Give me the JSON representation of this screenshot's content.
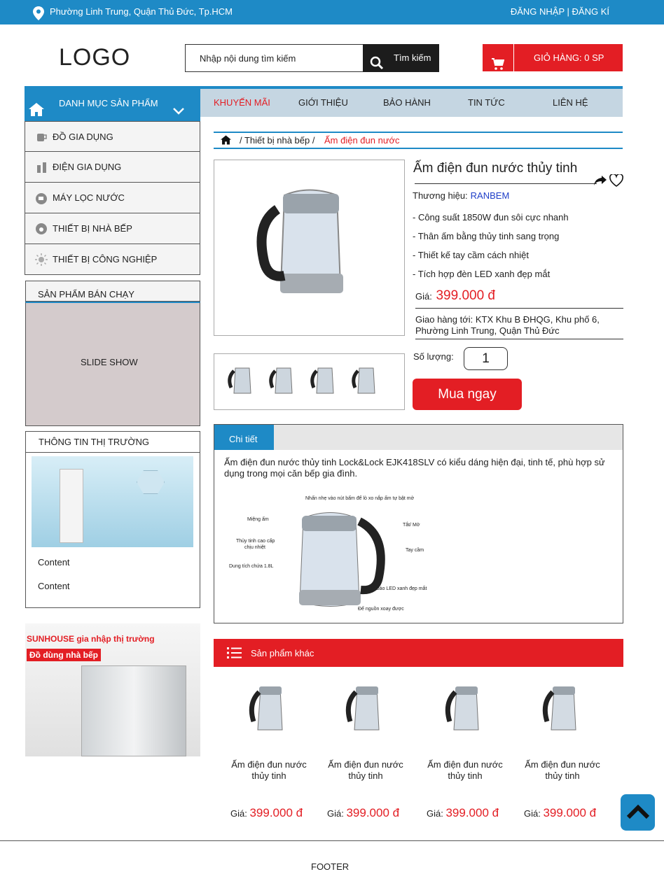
{
  "topbar": {
    "address": "Phường Linh Trung, Quận Thủ Đức, Tp.HCM",
    "login": "ĐĂNG NHẬP",
    "separator": "|",
    "register": "ĐĂNG KÍ"
  },
  "header": {
    "logo": "LOGO",
    "search_placeholder": "Nhập nội dung tìm kiếm",
    "search_button": "Tìm kiếm",
    "cart_label": "GIỎ HÀNG: 0 SP"
  },
  "nav": {
    "category_label": "DANH MỤC SẢN PHẨM",
    "menu": [
      "KHUYẾN MÃI",
      "GIỚI THIỆU",
      "BẢO HÀNH",
      "TIN TỨC",
      "LIÊN HỆ"
    ]
  },
  "categories": [
    "ĐỒ GIA DỤNG",
    "ĐIỆN GIA DỤNG",
    "MÁY LỌC NƯỚC",
    "THIẾT BỊ NHÀ BẾP",
    "THIẾT  BỊ CÔNG NGHIỆP"
  ],
  "sidebar": {
    "bestseller_title": "SẢN PHẨM BÁN CHẠY",
    "slideshow": "SLIDE SHOW",
    "news_title": "THÔNG TIN THỊ TRƯỜNG",
    "content1": "Content",
    "content2": "Content",
    "banner_line1": "SUNHOUSE gia nhập thị trường",
    "banner_line2": "Đồ dùng nhà bếp"
  },
  "breadcrumb": {
    "level1": "/ Thiết bị nhà bếp /",
    "current": "Ấm điện đun nước"
  },
  "product": {
    "name": "Ấm điện đun nước thủy tinh",
    "brand_label": "Thương hiệu:",
    "brand": "RANBEM",
    "features": [
      "- Công suất 1850W đun sôi cực nhanh",
      "- Thân ấm bằng thủy tinh sang trọng",
      "- Thiết kế tay cầm cách nhiệt",
      "- Tích hợp đèn LED xanh đẹp mắt"
    ],
    "price_label": "Giá:",
    "price": "399.000 đ",
    "ship_line1": "Giao hàng tới: KTX Khu B ĐHQG, Khu phố 6,",
    "ship_line2": "Phường Linh Trung, Quận Thủ Đức",
    "qty_label": "Số lượng:",
    "qty": "1",
    "buy": "Mua ngay"
  },
  "detail": {
    "tab": "Chi tiết",
    "description": "Ấm điện đun nước thủy tinh Lock&Lock EJK418SLV có kiểu dáng hiện đại, tinh tế, phù hợp sử dụng trong mọi căn bếp gia đình.",
    "diagram_labels": {
      "top": "Nhấn nhẹ vào nút bấm để lò xo nắp ấm tự bật mở",
      "mouth": "Miệng ấm",
      "onoff": "Tắt/ Mở",
      "glass1": "Thủy tinh cao cấp",
      "glass2": "chịu nhiệt",
      "handle": "Tay cầm",
      "capacity": "Dung tích chứa 1.8L",
      "led": "Đèn báo LED xanh đẹp mắt",
      "base": "Đế nguồn xoay được"
    }
  },
  "others": {
    "title": "Sản phẩm khác",
    "items": [
      {
        "name": "Ấm điện đun nước thủy tinh",
        "price_label": "Giá:",
        "price": "399.000 đ"
      },
      {
        "name": "Ấm điện đun nước thủy tinh",
        "price_label": "Giá:",
        "price": "399.000 đ"
      },
      {
        "name": "Ấm điện đun nước thủy tinh",
        "price_label": "Giá:",
        "price": "399.000 đ"
      },
      {
        "name": "Ấm điện đun nước thủy tinh",
        "price_label": "Giá:",
        "price": "399.000 đ"
      }
    ]
  },
  "footer": "FOOTER",
  "colors": {
    "primary": "#1e8ac6",
    "accent": "#e31e24"
  }
}
